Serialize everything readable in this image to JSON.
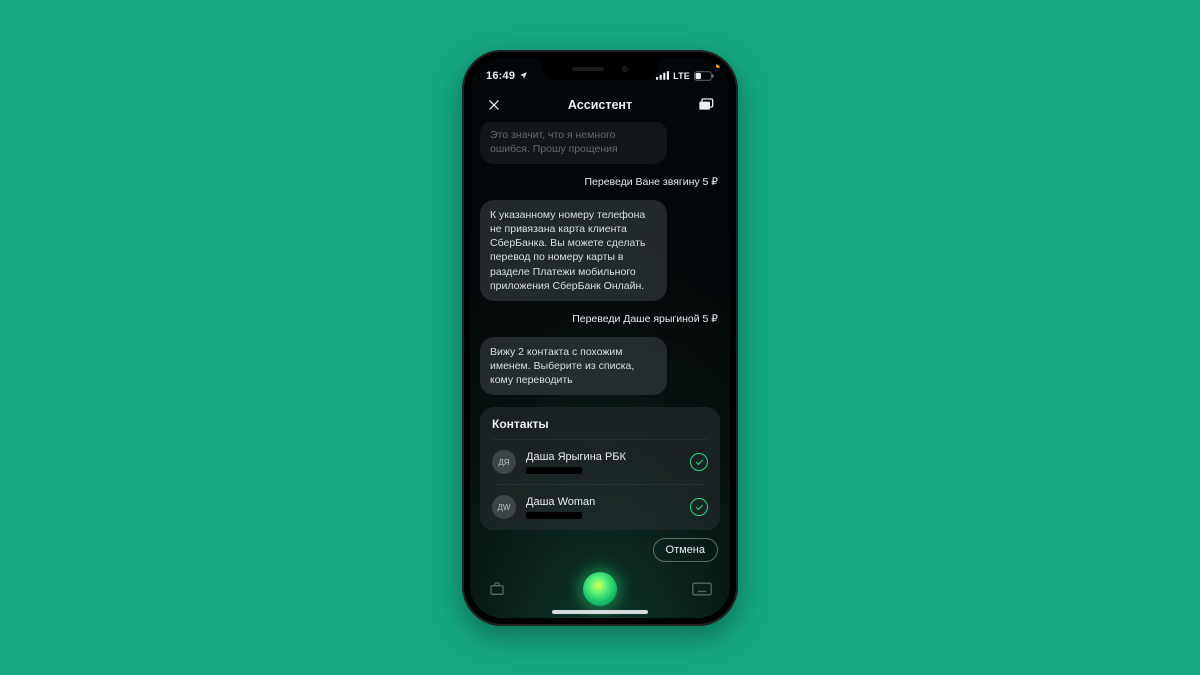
{
  "status": {
    "time": "16:49",
    "network_label": "LTE"
  },
  "nav": {
    "title": "Ассистент"
  },
  "chat": {
    "assistant_dim": "Это значит, что я немного ошибся. Прошу прощения",
    "user1": "Переведи Ване звягину 5 ₽",
    "assistant1": "К указанному номеру телефона не привязана карта клиента СберБанка. Вы можете сделать перевод по номеру карты в разделе Платежи мобильного приложения СберБанк Онлайн.",
    "user2": "Переведи Даше ярыгиной 5 ₽",
    "assistant2": "Вижу 2 контакта с похожим именем. Выберите из списка, кому переводить"
  },
  "contacts_card": {
    "title": "Контакты",
    "items": [
      {
        "initials": "ДЯ",
        "name": "Даша Ярыгина РБК"
      },
      {
        "initials": "ДW",
        "name": "Даша Woman"
      }
    ]
  },
  "actions": {
    "cancel": "Отмена"
  }
}
